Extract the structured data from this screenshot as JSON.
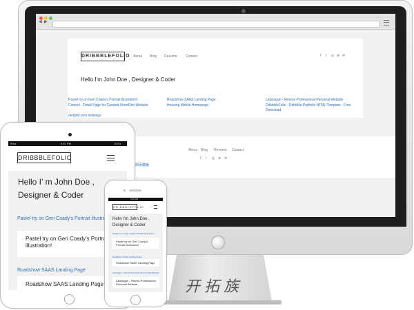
{
  "site": {
    "logo": "DRIBBBLEFOLIO",
    "nav": [
      "About",
      "Blog",
      "Resume",
      "Contact"
    ],
    "social_icons": [
      "facebook-icon",
      "twitter-icon",
      "github-icon",
      "dribbble-icon",
      "email-icon"
    ],
    "hero": "Hello I'm John Doe , Designer & Coder",
    "projects": [
      "Pastel try on Geri Coady's Portrait illustration!",
      "Roadshow SAAS Landing Page",
      "Lataragan - Fitness Professional Personal Website",
      "Cinevol - Detail Page for Curated ShortFilm Website",
      "Housing Mobile Homepage",
      "DribbbleFolio - Dribbble Portfolio HTML Template - Free Download"
    ],
    "credit": "rwdgrid.com redesign",
    "footer_credit": "网页模板"
  },
  "tablet": {
    "status_left": "iPad",
    "status_time": "9:41 PM",
    "status_right": "100%",
    "hero_line1": "Hello I’  m John Doe ,",
    "hero_line2": "Designer & Coder",
    "project1_link": "Pastel try on Geri Coady's Portrait illustration!",
    "project1_title": "Pastel try on Geri Coady's Portrait illustration!",
    "project2_link": "Roadshow SAAS Landing Page",
    "project2_title": "Roadshow SAAS Landing Page"
  },
  "phone": {
    "status_time": "9:41 PM",
    "hero": "Hello I'm John Doe , Designer & Coder",
    "project1_link": "Pastel try on Geri Coady's Portrait illustration!",
    "project1_title": "Pastel try on Geri Coady's Portrait illustration!",
    "project2_link": "Roadshow SAAS Landing Page",
    "project2_title": "Roadshow SAAS Landing Page",
    "project3_link": "Lataragan - Fitness Professional Personal Website",
    "project3_title": "Lataragan - Fitness Professional Personal Website"
  },
  "watermark": "开拓族",
  "colors": {
    "link": "#2b6bb7",
    "close": "#ee5c54",
    "minimize": "#f7be3b",
    "zoom": "#5fc64a"
  }
}
